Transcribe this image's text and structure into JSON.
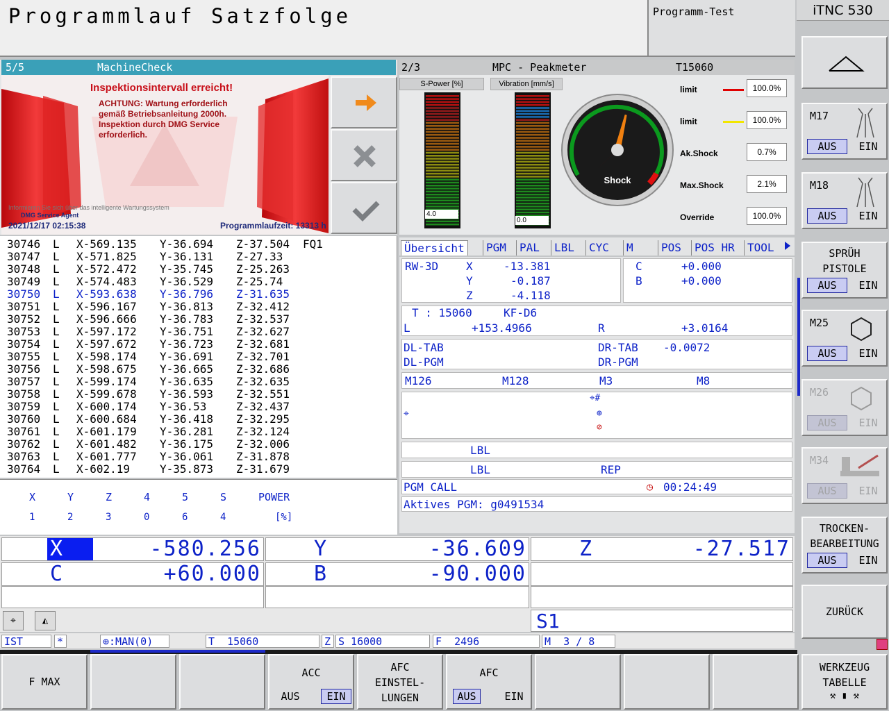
{
  "header": {
    "title": "Programmlauf Satzfolge",
    "mode2": "Programm-Test",
    "brand": "iTNC 530"
  },
  "machinecheck": {
    "page": "5/5",
    "title": "MachineCheck",
    "warn_title": "Inspektionsintervall erreicht!",
    "warn_text": [
      "ACHTUNG: Wartung erforderlich",
      "gemäß Betriebsanleitung 2000h.",
      "Inspektion durch DMG Service",
      "erforderlich."
    ],
    "footer_info": "Informieren Sie sich über das intelligente Wartungssystem",
    "agent": "DMG Service Agent",
    "date": "2021/12/17 02:15:38",
    "runtime": "Programmlaufzeit: 13313 h"
  },
  "mpc": {
    "page": "2/3",
    "title": "MPC - Peakmeter",
    "tool": "T15060",
    "spower_label": "S-Power [%]",
    "vib_label": "Vibration [mm/s]",
    "spower_val": "4.0",
    "vib_val": "0.0",
    "gauge_label": "Shock",
    "gauge_value_fraction": 0.55,
    "rows": [
      {
        "label": "limit",
        "value": "100.0%",
        "color": "#e00000"
      },
      {
        "label": "limit",
        "value": "100.0%",
        "color": "#f2e600"
      },
      {
        "label": "Ak.Shock",
        "value": "0.7%"
      },
      {
        "label": "Max.Shock",
        "value": "2.1%"
      },
      {
        "label": "Override",
        "value": "100.0%"
      }
    ]
  },
  "program": {
    "lines": [
      {
        "n": "30746",
        "t": "L",
        "x": "X-569.135",
        "y": "Y-36.694",
        "z": "Z-37.504",
        "e": "FQ1"
      },
      {
        "n": "30747",
        "t": "L",
        "x": "X-571.825",
        "y": "Y-36.131",
        "z": "Z-27.33",
        "e": ""
      },
      {
        "n": "30748",
        "t": "L",
        "x": "X-572.472",
        "y": "Y-35.745",
        "z": "Z-25.263",
        "e": ""
      },
      {
        "n": "30749",
        "t": "L",
        "x": "X-574.483",
        "y": "Y-36.529",
        "z": "Z-25.74",
        "e": ""
      },
      {
        "n": "30750",
        "t": "L",
        "x": "X-593.638",
        "y": "Y-36.796",
        "z": "Z-31.635",
        "e": "",
        "active": true
      },
      {
        "n": "30751",
        "t": "L",
        "x": "X-596.167",
        "y": "Y-36.813",
        "z": "Z-32.412",
        "e": ""
      },
      {
        "n": "30752",
        "t": "L",
        "x": "X-596.666",
        "y": "Y-36.783",
        "z": "Z-32.537",
        "e": ""
      },
      {
        "n": "30753",
        "t": "L",
        "x": "X-597.172",
        "y": "Y-36.751",
        "z": "Z-32.627",
        "e": ""
      },
      {
        "n": "30754",
        "t": "L",
        "x": "X-597.672",
        "y": "Y-36.723",
        "z": "Z-32.681",
        "e": ""
      },
      {
        "n": "30755",
        "t": "L",
        "x": "X-598.174",
        "y": "Y-36.691",
        "z": "Z-32.701",
        "e": ""
      },
      {
        "n": "30756",
        "t": "L",
        "x": "X-598.675",
        "y": "Y-36.665",
        "z": "Z-32.686",
        "e": ""
      },
      {
        "n": "30757",
        "t": "L",
        "x": "X-599.174",
        "y": "Y-36.635",
        "z": "Z-32.635",
        "e": ""
      },
      {
        "n": "30758",
        "t": "L",
        "x": "X-599.678",
        "y": "Y-36.593",
        "z": "Z-32.551",
        "e": ""
      },
      {
        "n": "30759",
        "t": "L",
        "x": "X-600.174",
        "y": "Y-36.53",
        "z": "Z-32.437",
        "e": ""
      },
      {
        "n": "30760",
        "t": "L",
        "x": "X-600.684",
        "y": "Y-36.418",
        "z": "Z-32.295",
        "e": ""
      },
      {
        "n": "30761",
        "t": "L",
        "x": "X-601.179",
        "y": "Y-36.281",
        "z": "Z-32.124",
        "e": ""
      },
      {
        "n": "30762",
        "t": "L",
        "x": "X-601.482",
        "y": "Y-36.175",
        "z": "Z-32.006",
        "e": ""
      },
      {
        "n": "30763",
        "t": "L",
        "x": "X-601.777",
        "y": "Y-36.061",
        "z": "Z-31.878",
        "e": ""
      },
      {
        "n": "30764",
        "t": "L",
        "x": "X-602.19",
        "y": "Y-35.873",
        "z": "Z-31.679",
        "e": ""
      }
    ]
  },
  "mini": {
    "axes": [
      "X",
      "Y",
      "Z",
      "4",
      "5",
      "S",
      "POWER"
    ],
    "vals": [
      "1",
      "2",
      "3",
      "0",
      "6",
      "4",
      "[%]"
    ]
  },
  "tabs": [
    "Übersicht",
    "PGM",
    "PAL",
    "LBL",
    "CYC",
    "M",
    "POS",
    "POS HR",
    "TOOL"
  ],
  "status": {
    "rw": "RW-3D",
    "X": "-13.381",
    "Y": "-0.187",
    "Z": "-4.118",
    "C": "+0.000",
    "B": "+0.000",
    "tool_t": "T : 15060",
    "tool_name": "KF-D6",
    "L_label": "L",
    "L": "+153.4966",
    "R_label": "R",
    "R": "+3.0164",
    "dl_tab": "DL-TAB",
    "dl_pgm": "DL-PGM",
    "dr_tab": "DR-TAB",
    "dr_tab_val": "-0.0072",
    "dr_pgm": "DR-PGM",
    "m": [
      "M126",
      "M128",
      "M3",
      "M8"
    ],
    "lbl1": "LBL",
    "lbl2": "LBL",
    "rep": "REP",
    "pgm_call": "PGM CALL",
    "time": "00:24:49",
    "active_pgm": "Aktives PGM: g0491534"
  },
  "pos": {
    "X": "-580.256",
    "Y": "-36.609",
    "Z": "-27.517",
    "C": "+60.000",
    "B": "-90.000",
    "S": "S1"
  },
  "statusbar": {
    "ist": "IST",
    "star": "*",
    "man": ":MAN(0)",
    "t": "T  15060",
    "z": "Z",
    "s": "S 16000",
    "f": "F  2496",
    "m": "M  3 / 8"
  },
  "right_softkeys": {
    "m17": "M17",
    "m18": "M18",
    "spray": [
      "SPRÜH",
      "PISTOLE"
    ],
    "m25": "M25",
    "m26": "M26",
    "m34": "M34",
    "dry": [
      "TROCKEN-",
      "BEARBEITUNG"
    ],
    "back": "ZURÜCK",
    "aus": "AUS",
    "ein": "EIN"
  },
  "bottom_softkeys": {
    "fmax": "F MAX",
    "acc": "ACC",
    "afc_set": [
      "AFC",
      "EINSTEL-",
      "LUNGEN"
    ],
    "afc": "AFC",
    "aus": "AUS",
    "ein": "EIN",
    "tooltab": [
      "WERKZEUG",
      "TABELLE"
    ]
  }
}
